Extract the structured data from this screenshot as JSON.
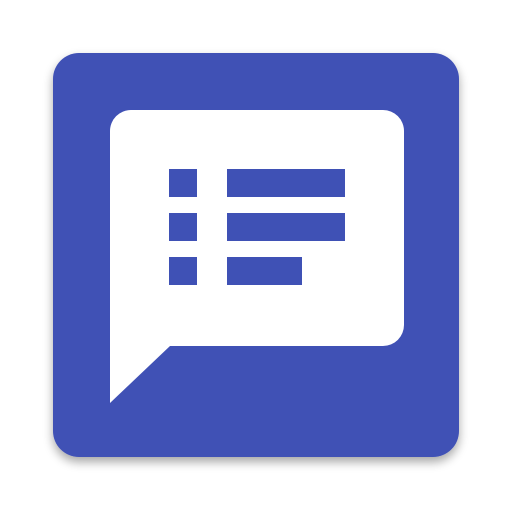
{
  "icon": {
    "name": "chat-list-icon",
    "colors": {
      "tile": "#3F51B5",
      "bubble": "#FFFFFF",
      "list_marks": "#3F51B5",
      "shadow": "#000000"
    },
    "list_rows": 3,
    "rows": [
      {
        "bullet": true,
        "bar_fraction": 1.0
      },
      {
        "bullet": true,
        "bar_fraction": 1.0
      },
      {
        "bullet": true,
        "bar_fraction": 0.64
      }
    ]
  }
}
